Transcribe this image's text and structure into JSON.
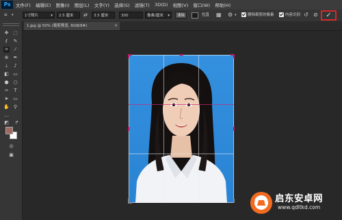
{
  "app": {
    "logo": "Ps"
  },
  "menu": [
    "文件(F)",
    "编辑(E)",
    "图像(I)",
    "图层(L)",
    "文字(Y)",
    "选择(S)",
    "滤镜(T)",
    "3D(D)",
    "视图(V)",
    "窗口(W)",
    "帮助(H)"
  ],
  "options": {
    "ratio_preset": "1寸照片",
    "width_value": "2.5 厘米",
    "height_value": "3.5 厘米",
    "resolution_value": "300",
    "resolution_unit": "像素/厘米",
    "clear_button": "清除",
    "straighten_label": "拉直",
    "delete_cropped_label": "删除裁剪的像素",
    "content_aware_label": "内容识别"
  },
  "tab": {
    "title": "1.jpg @ 50% (裁剪预览, RGB/8#)",
    "close": "×"
  },
  "colors": {
    "foreground": "#9c6a5e",
    "background": "#ffffff",
    "photo_bg": "#2f88d8",
    "accent_handle": "#c2185b"
  },
  "watermark": {
    "text": "启东安卓网",
    "url": "www.qdltkd.com"
  }
}
